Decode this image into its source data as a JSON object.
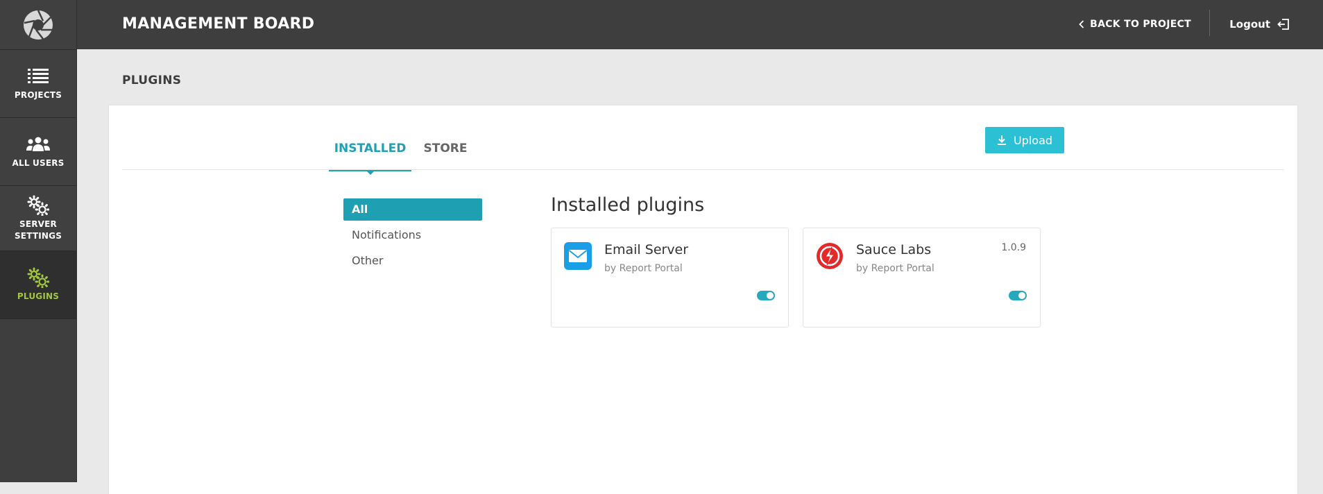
{
  "app": {
    "header_title": "MANAGEMENT BOARD",
    "back_link": "BACK TO PROJECT",
    "logout": "Logout"
  },
  "sidebar": {
    "items": [
      {
        "label": "PROJECTS",
        "icon": "list-icon"
      },
      {
        "label": "ALL USERS",
        "icon": "users-icon"
      },
      {
        "label_line1": "SERVER",
        "label_line2": "SETTINGS",
        "icon": "gears-icon"
      },
      {
        "label": "PLUGINS",
        "icon": "plugins-icon",
        "active": true
      }
    ]
  },
  "page": {
    "title": "PLUGINS",
    "tabs": [
      {
        "label": "INSTALLED",
        "active": true
      },
      {
        "label": "STORE",
        "active": false
      }
    ],
    "upload_label": "Upload",
    "filters": [
      {
        "label": "All",
        "active": true
      },
      {
        "label": "Notifications",
        "active": false
      },
      {
        "label": "Other",
        "active": false
      }
    ],
    "section_title": "Installed plugins",
    "plugins": [
      {
        "name": "Email Server",
        "author": "by Report Portal",
        "version": "",
        "enabled": true,
        "icon": "email-icon"
      },
      {
        "name": "Sauce Labs",
        "author": "by Report Portal",
        "version": "1.0.9",
        "enabled": true,
        "icon": "sauce-labs-icon"
      }
    ]
  },
  "colors": {
    "accent": "#1da1b3",
    "button": "#2bc0d4",
    "active_nav": "#a3c644",
    "header_bg": "#3e3e3e"
  }
}
